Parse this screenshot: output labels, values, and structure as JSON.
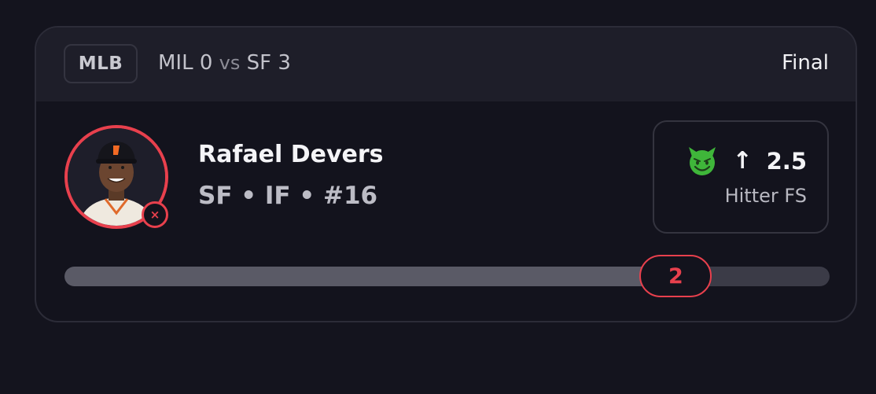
{
  "game": {
    "league": "MLB",
    "away_team": "MIL",
    "away_score": "0",
    "vs": "vs",
    "home_team": "SF",
    "home_score": "3",
    "status": "Final"
  },
  "player": {
    "name": "Rafael Devers",
    "meta": "SF • IF • #16",
    "result_icon": "cancel-icon",
    "result_symbol": "×"
  },
  "projection": {
    "icon": "smiling-devil-icon",
    "direction": "↑",
    "line": "2.5",
    "stat_type": "Hitter FS"
  },
  "progress": {
    "actual_value": "2",
    "fraction": 0.799
  },
  "colors": {
    "accent_red": "#e8404d",
    "background": "#14141e",
    "card_header": "#1e1e29",
    "devil_green": "#3fb63a"
  }
}
